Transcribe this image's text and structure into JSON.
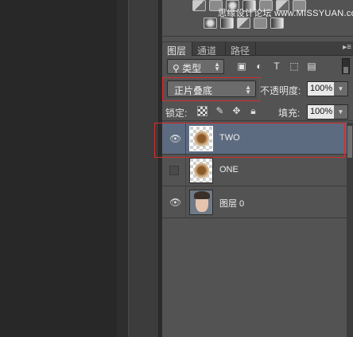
{
  "watermark": {
    "text": "思缘设计论坛 ",
    "sub": "www.MISSYUAN.com"
  },
  "tabs": [
    {
      "label": "图层",
      "active": true
    },
    {
      "label": "通道",
      "active": false
    },
    {
      "label": "路径",
      "active": false
    }
  ],
  "filter": {
    "label": "类型",
    "icons": [
      "image-filter-icon",
      "adjustment-filter-icon",
      "type-filter-icon",
      "shape-filter-icon",
      "smart-object-filter-icon"
    ]
  },
  "blend": {
    "mode": "正片叠底",
    "opacity_label": "不透明度:",
    "opacity_value": "100%"
  },
  "lock": {
    "label": "锁定:",
    "fill_label": "填充:",
    "fill_value": "100%"
  },
  "layers": [
    {
      "name": "TWO",
      "visible": true,
      "selected": true,
      "thumb": "ornament"
    },
    {
      "name": "ONE",
      "visible": false,
      "selected": false,
      "thumb": "ornament"
    },
    {
      "name": "图层 0",
      "visible": true,
      "selected": false,
      "thumb": "portrait"
    }
  ],
  "colors": {
    "highlight": "#d62c2c",
    "selected_row": "#5d6b80",
    "panel_bg": "#535353"
  }
}
